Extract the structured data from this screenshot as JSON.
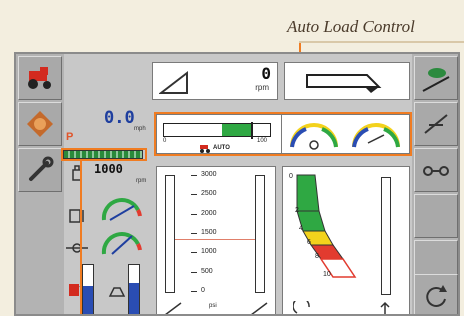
{
  "callout": {
    "title": "Auto Load Control"
  },
  "top_panel": {
    "rpm_value": "0",
    "rpm_unit": "rpm"
  },
  "left_readouts": {
    "speed": "0.0",
    "speed_unit": "mph",
    "gear_marker": "P",
    "engine_rpm": "1000",
    "engine_rpm_unit": "rpm"
  },
  "auto_load": {
    "bar_min": "0",
    "bar_max": "100",
    "bar_label": "AUTO",
    "fill_start_fraction": 0.55,
    "fill_end_fraction": 0.82
  },
  "hydraulic_scale": {
    "labels": [
      "3000",
      "2500",
      "2000",
      "1500",
      "1000",
      "500",
      "0"
    ],
    "unit": "psi"
  },
  "tilt_gauge": {
    "labels": [
      "0",
      "2",
      "4",
      "6",
      "8",
      "10"
    ]
  },
  "colors": {
    "accent_orange": "#f07c22",
    "green": "#2fa843",
    "yellow": "#f3d21c",
    "red": "#e23b2f",
    "blue": "#2a4db3"
  },
  "icons": {
    "left_side": [
      "tractor-icon",
      "engine-icon",
      "wrench-icon"
    ],
    "right_side": [
      "turtle-icon",
      "implement-icon",
      "hitch-icon",
      "blank",
      "blank",
      "rotate-icon"
    ],
    "readouts": [
      "fuel-icon",
      "oil-icon",
      "coolant-icon",
      "def-icon"
    ]
  }
}
